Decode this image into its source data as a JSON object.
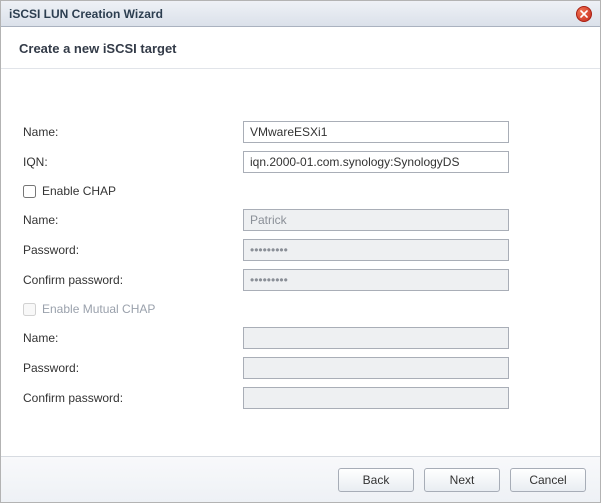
{
  "window": {
    "title": "iSCSI LUN Creation Wizard"
  },
  "subheader": "Create a new iSCSI target",
  "fields": {
    "name_label": "Name:",
    "name_value": "VMwareESXi1",
    "iqn_label": "IQN:",
    "iqn_value": "iqn.2000-01.com.synology:SynologyDS"
  },
  "chap": {
    "enable_label": "Enable CHAP",
    "enable_checked": false,
    "name_label": "Name:",
    "name_value": "Patrick",
    "password_label": "Password:",
    "password_value": "•••••••••",
    "confirm_label": "Confirm password:",
    "confirm_value": "•••••••••"
  },
  "mutual": {
    "enable_label": "Enable Mutual CHAP",
    "enable_checked": false,
    "name_label": "Name:",
    "name_value": "",
    "password_label": "Password:",
    "password_value": "",
    "confirm_label": "Confirm password:",
    "confirm_value": ""
  },
  "buttons": {
    "back": "Back",
    "next": "Next",
    "cancel": "Cancel"
  }
}
